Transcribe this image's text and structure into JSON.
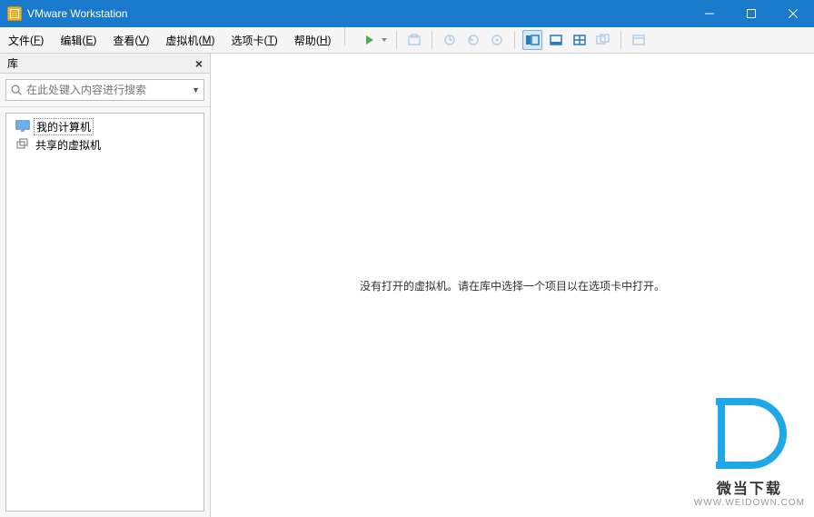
{
  "title": "VMware Workstation",
  "menus": {
    "file": {
      "label": "文件",
      "key": "F"
    },
    "edit": {
      "label": "编辑",
      "key": "E"
    },
    "view": {
      "label": "查看",
      "key": "V"
    },
    "vm": {
      "label": "虚拟机",
      "key": "M"
    },
    "tabs": {
      "label": "选项卡",
      "key": "T"
    },
    "help": {
      "label": "帮助",
      "key": "H"
    }
  },
  "sidebar": {
    "title": "库",
    "search_placeholder": "在此处键入内容进行搜索",
    "items": [
      {
        "label": "我的计算机",
        "icon": "monitor"
      },
      {
        "label": "共享的虚拟机",
        "icon": "share"
      }
    ]
  },
  "main": {
    "empty_message": "没有打开的虚拟机。请在库中选择一个项目以在选项卡中打开。"
  },
  "watermark": {
    "line1": "微当下载",
    "line2": "WWW.WEIDOWN.COM"
  }
}
